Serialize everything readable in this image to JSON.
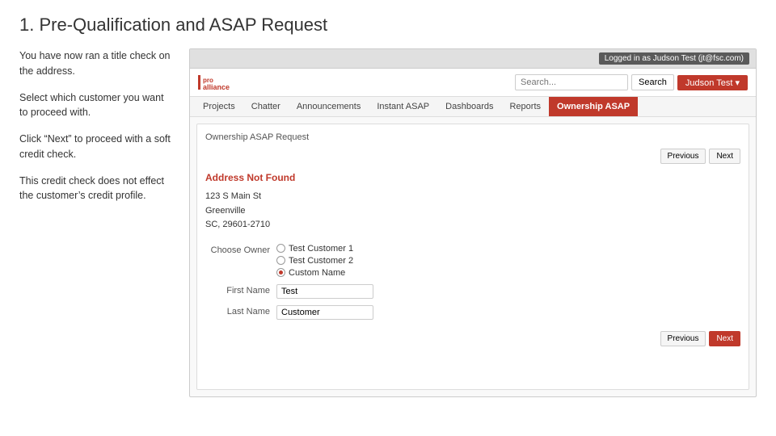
{
  "page": {
    "title": "1. Pre-Qualification and ASAP Request"
  },
  "left_panel": {
    "blocks": [
      {
        "id": "block1",
        "text": "You have now ran a title check on the address."
      },
      {
        "id": "block2",
        "text": "Select which customer you want to proceed with."
      },
      {
        "id": "block3",
        "text": "Click “Next” to proceed with a soft credit check."
      },
      {
        "id": "block4",
        "text": "This credit check does not effect the customer’s credit profile."
      }
    ]
  },
  "app": {
    "logged_in_label": "Logged in as Judson Test (jt@fsc.com)",
    "logo_top": "pro",
    "logo_bottom": "alliance",
    "search_placeholder": "Search...",
    "search_btn_label": "Search",
    "user_btn_label": "Judson Test ▾",
    "nav_items": [
      {
        "id": "projects",
        "label": "Projects",
        "active": false
      },
      {
        "id": "chatter",
        "label": "Chatter",
        "active": false
      },
      {
        "id": "announcements",
        "label": "Announcements",
        "active": false
      },
      {
        "id": "instant_asap",
        "label": "Instant ASAP",
        "active": false
      },
      {
        "id": "dashboards",
        "label": "Dashboards",
        "active": false
      },
      {
        "id": "reports",
        "label": "Reports",
        "active": false
      },
      {
        "id": "ownership_asap",
        "label": "Ownership ASAP",
        "active": true
      }
    ],
    "section_title": "Ownership ASAP Request",
    "btn_previous": "Previous",
    "btn_next": "Next",
    "address_not_found": "Address Not Found",
    "address_lines": [
      "123 S Main St",
      "Greenville",
      "SC, 29601-2710"
    ],
    "form": {
      "choose_owner_label": "Choose Owner",
      "options": [
        {
          "id": "cust1",
          "label": "Test Customer 1",
          "selected": false
        },
        {
          "id": "cust2",
          "label": "Test Customer 2",
          "selected": false
        },
        {
          "id": "custom",
          "label": "Custom Name",
          "selected": true
        }
      ],
      "first_name_label": "First Name",
      "first_name_value": "Test",
      "last_name_label": "Last Name",
      "last_name_value": "Customer"
    }
  }
}
